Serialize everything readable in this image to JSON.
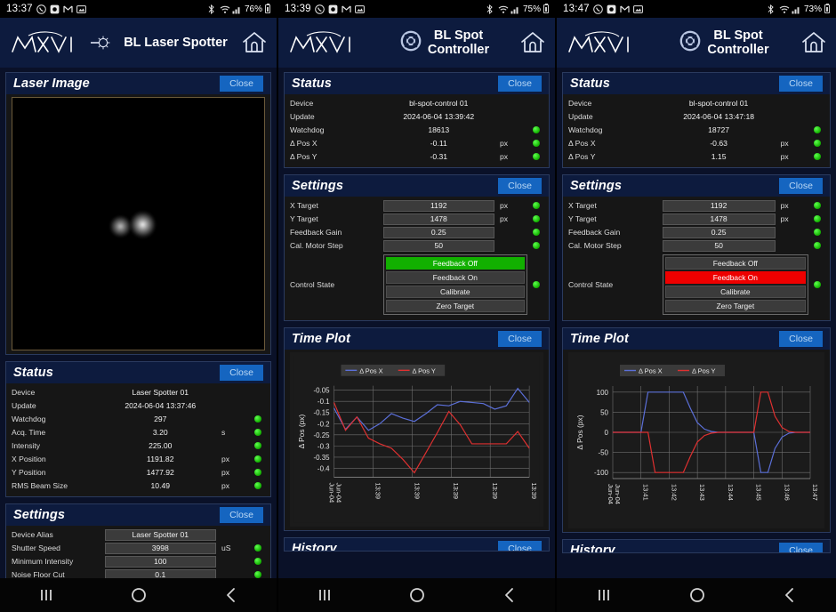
{
  "accent": {
    "card_header_bg": "#0d1b3e",
    "close_btn": "#1565c0",
    "led_green": "#12b000",
    "feedback_on_red": "#ee0000",
    "series_x": "#5b6fd8",
    "series_y": "#e03030"
  },
  "panels": [
    {
      "statusbar": {
        "time": "13:37",
        "battery": "76%",
        "icons": [
          "whatsapp-icon",
          "app-icon",
          "messenger-icon",
          "screenshot-icon",
          "bluetooth-icon",
          "wifi-icon",
          "signal-icon",
          "battery-icon"
        ]
      },
      "header": {
        "logo": "MAX IV",
        "title": "BL Laser Spotter",
        "home": "home-icon"
      },
      "cards": [
        {
          "id": "laser-image",
          "title": "Laser Image",
          "close": "Close",
          "type": "image"
        },
        {
          "id": "status",
          "title": "Status",
          "close": "Close",
          "type": "rows",
          "rows": [
            {
              "label": "Device",
              "value": "Laser Spotter 01",
              "unit": "",
              "led": false
            },
            {
              "label": "Update",
              "value": "2024-06-04 13:37:46",
              "unit": "",
              "led": false
            },
            {
              "label": "Watchdog",
              "value": "297",
              "unit": "",
              "led": true
            },
            {
              "label": "Acq. Time",
              "value": "3.20",
              "unit": "s",
              "led": true
            },
            {
              "label": "Intensity",
              "value": "225.00",
              "unit": "",
              "led": true
            },
            {
              "label": "X Position",
              "value": "1191.82",
              "unit": "px",
              "led": true
            },
            {
              "label": "Y Position",
              "value": "1477.92",
              "unit": "px",
              "led": true
            },
            {
              "label": "RMS Beam Size",
              "value": "10.49",
              "unit": "px",
              "led": true
            }
          ]
        },
        {
          "id": "settings",
          "title": "Settings",
          "close": "Close",
          "type": "fields",
          "rows": [
            {
              "label": "Device Alias",
              "value": "Laser Spotter 01",
              "unit": "",
              "led": false
            },
            {
              "label": "Shutter Speed",
              "value": "3998",
              "unit": "uS",
              "led": true
            },
            {
              "label": "Minimum Intensity",
              "value": "100",
              "unit": "",
              "led": true
            },
            {
              "label": "Noise Floor Cut",
              "value": "0.1",
              "unit": "",
              "led": true
            }
          ]
        }
      ]
    },
    {
      "statusbar": {
        "time": "13:39",
        "battery": "75%"
      },
      "header": {
        "logo": "MAX IV",
        "title": "BL Spot Controller",
        "icon": "target-ring-icon",
        "home": "home-icon"
      },
      "cards": [
        {
          "id": "status",
          "title": "Status",
          "close": "Close",
          "type": "rows",
          "rows": [
            {
              "label": "Device",
              "value": "bl-spot-control 01",
              "unit": "",
              "led": false
            },
            {
              "label": "Update",
              "value": "2024-06-04 13:39:42",
              "unit": "",
              "led": false
            },
            {
              "label": "Watchdog",
              "value": "18613",
              "unit": "",
              "led": true
            },
            {
              "label": "Δ Pos X",
              "value": "-0.11",
              "unit": "px",
              "led": true
            },
            {
              "label": "Δ Pos Y",
              "value": "-0.31",
              "unit": "px",
              "led": true
            }
          ]
        },
        {
          "id": "settings",
          "title": "Settings",
          "close": "Close",
          "type": "fields",
          "rows": [
            {
              "label": "X Target",
              "value": "1192",
              "unit": "px",
              "led": true
            },
            {
              "label": "Y Target",
              "value": "1478",
              "unit": "px",
              "led": true
            },
            {
              "label": "Feedback Gain",
              "value": "0.25",
              "unit": "",
              "led": true
            },
            {
              "label": "Cal. Motor Step",
              "value": "50",
              "unit": "",
              "led": true
            }
          ],
          "control": {
            "label": "Control State",
            "active": "Feedback Off",
            "active_color": "green",
            "options": [
              "Feedback Off",
              "Feedback On",
              "Calibrate",
              "Zero Target"
            ]
          }
        },
        {
          "id": "time-plot",
          "title": "Time Plot",
          "close": "Close",
          "type": "plot",
          "plot_index": 0
        },
        {
          "id": "history",
          "title": "History",
          "close": "Close",
          "type": "clipped"
        }
      ]
    },
    {
      "statusbar": {
        "time": "13:47",
        "battery": "73%"
      },
      "header": {
        "logo": "MAX IV",
        "title": "BL Spot Controller",
        "icon": "target-ring-icon",
        "home": "home-icon"
      },
      "cards": [
        {
          "id": "status",
          "title": "Status",
          "close": "Close",
          "type": "rows",
          "rows": [
            {
              "label": "Device",
              "value": "bl-spot-control 01",
              "unit": "",
              "led": false
            },
            {
              "label": "Update",
              "value": "2024-06-04 13:47:18",
              "unit": "",
              "led": false
            },
            {
              "label": "Watchdog",
              "value": "18727",
              "unit": "",
              "led": true
            },
            {
              "label": "Δ Pos X",
              "value": "-0.63",
              "unit": "px",
              "led": true
            },
            {
              "label": "Δ Pos Y",
              "value": "1.15",
              "unit": "px",
              "led": true
            }
          ]
        },
        {
          "id": "settings",
          "title": "Settings",
          "close": "Close",
          "type": "fields",
          "rows": [
            {
              "label": "X Target",
              "value": "1192",
              "unit": "px",
              "led": true
            },
            {
              "label": "Y Target",
              "value": "1478",
              "unit": "px",
              "led": true
            },
            {
              "label": "Feedback Gain",
              "value": "0.25",
              "unit": "",
              "led": true
            },
            {
              "label": "Cal. Motor Step",
              "value": "50",
              "unit": "",
              "led": true
            }
          ],
          "control": {
            "label": "Control State",
            "active": "Feedback On",
            "active_color": "red",
            "options": [
              "Feedback Off",
              "Feedback On",
              "Calibrate",
              "Zero Target"
            ]
          }
        },
        {
          "id": "time-plot",
          "title": "Time Plot",
          "close": "Close",
          "type": "plot",
          "plot_index": 1
        },
        {
          "id": "history",
          "title": "History",
          "close": "Close",
          "type": "clipped"
        }
      ]
    }
  ],
  "navbar": {
    "recents": "recents-icon",
    "home": "home-circle-icon",
    "back": "back-icon"
  },
  "chart_data": [
    {
      "type": "line",
      "title": "Time Plot",
      "ylabel": "Δ Pos (px)",
      "xlabel": "",
      "legend": [
        "Δ Pos X",
        "Δ Pos Y"
      ],
      "legend_position": "top-left",
      "grid": true,
      "ylim": [
        -0.44,
        -0.03
      ],
      "yticks": [
        -0.05,
        -0.1,
        -0.15,
        -0.2,
        -0.25,
        -0.3,
        -0.35,
        -0.4
      ],
      "xticks": [
        "Jun-04",
        "13:39",
        "13:39",
        "13:39",
        "13:39",
        "13:39"
      ],
      "x": [
        0,
        1,
        2,
        3,
        4,
        5,
        6,
        7,
        8,
        9,
        10,
        11,
        12,
        13,
        14,
        15,
        16,
        17
      ],
      "series": [
        {
          "name": "Δ Pos X",
          "color": "#5b6fd8",
          "values": [
            -0.13,
            -0.225,
            -0.17,
            -0.23,
            -0.2,
            -0.155,
            -0.175,
            -0.19,
            -0.155,
            -0.115,
            -0.12,
            -0.1,
            -0.105,
            -0.11,
            -0.135,
            -0.12,
            -0.042,
            -0.105
          ]
        },
        {
          "name": "Δ Pos Y",
          "color": "#e03030",
          "values": [
            -0.105,
            -0.23,
            -0.17,
            -0.265,
            -0.29,
            -0.31,
            -0.36,
            -0.42,
            -0.33,
            -0.24,
            -0.145,
            -0.205,
            -0.29,
            -0.29,
            -0.29,
            -0.29,
            -0.235,
            -0.31
          ]
        }
      ]
    },
    {
      "type": "line",
      "title": "Time Plot",
      "ylabel": "Δ Pos (px)",
      "xlabel": "",
      "legend": [
        "Δ Pos X",
        "Δ Pos Y"
      ],
      "legend_position": "top-left",
      "grid": true,
      "ylim": [
        -115,
        115
      ],
      "yticks": [
        100,
        50,
        0,
        -50,
        -100
      ],
      "xticks": [
        "Jun-04",
        "13:41",
        "13:42",
        "13:43",
        "13:44",
        "13:45",
        "13:46",
        "13:47"
      ],
      "x": [
        0,
        1,
        2,
        3,
        4,
        5,
        6,
        7,
        8,
        9,
        10,
        11,
        12,
        13,
        14,
        15,
        16,
        17,
        18,
        19,
        20,
        21,
        22,
        23,
        24,
        25,
        26,
        27,
        28
      ],
      "series": [
        {
          "name": "Δ Pos X",
          "color": "#5b6fd8",
          "values": [
            0,
            0,
            0,
            0,
            0,
            100,
            100,
            100,
            100,
            100,
            100,
            60,
            24,
            8,
            2,
            0,
            0,
            0,
            0,
            0,
            0,
            -100,
            -100,
            -40,
            -12,
            -2,
            0,
            0,
            0
          ]
        },
        {
          "name": "Δ Pos Y",
          "color": "#e03030",
          "values": [
            0,
            0,
            0,
            0,
            0,
            0,
            -100,
            -100,
            -100,
            -100,
            -100,
            -60,
            -24,
            -8,
            -2,
            0,
            0,
            0,
            0,
            0,
            0,
            100,
            100,
            40,
            12,
            2,
            0,
            0,
            0
          ]
        }
      ]
    }
  ]
}
